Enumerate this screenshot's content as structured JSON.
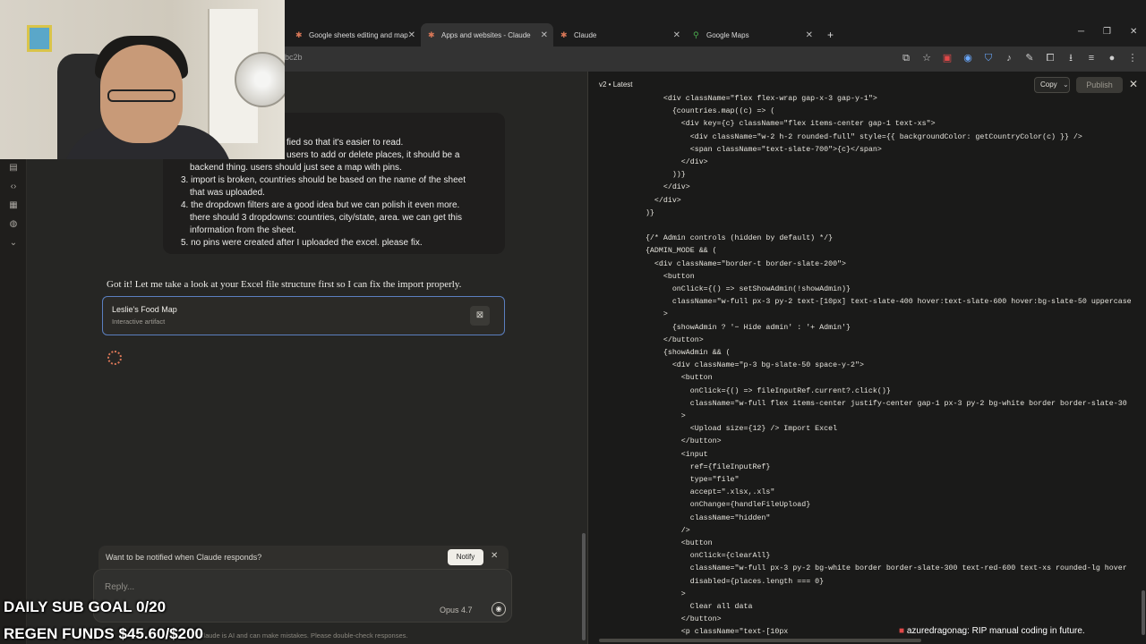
{
  "browser": {
    "tabs": [
      {
        "label": "Google sheets editing and map",
        "active": false
      },
      {
        "label": "Apps and websites - Claude",
        "active": true
      },
      {
        "label": "Claude",
        "active": false
      },
      {
        "label": "Google Maps",
        "active": false
      }
    ],
    "url_fragment": "bc2b"
  },
  "conversation": {
    "user_message_lines": [
      "fied so that it's easier to read.",
      "users to add or delete places, it should be a",
      "backend thing. users should just see a map with pins.",
      "3. import is broken, countries should be based on the name of the sheet",
      "that was uploaded.",
      "4. the dropdown filters are a good idea but we can polish it even more.",
      "there should 3 dropdowns: countries, city/state, area. we can get this",
      "information from the sheet.",
      "5. no pins were created after I uploaded the excel. please fix."
    ],
    "assistant_reply": "Got it! Let me take a look at your Excel file structure first so I can fix the import properly.",
    "artifact": {
      "title": "Leslie's Food Map",
      "subtitle": "Interactive artifact"
    },
    "notify_prompt": "Want to be notified when Claude responds?",
    "notify_button": "Notify",
    "reply_placeholder": "Reply...",
    "model": "Opus 4.7",
    "disclaimer": "Claude is AI and can make mistakes. Please double-check responses."
  },
  "code_panel": {
    "version": "v2 • Latest",
    "copy_label": "Copy",
    "publish_label": "Publish",
    "lines": [
      "      <div className=\"flex flex-wrap gap-x-3 gap-y-1\">",
      "        {countries.map((c) => (",
      "          <div key={c} className=\"flex items-center gap-1 text-xs\">",
      "            <div className=\"w-2 h-2 rounded-full\" style={{ backgroundColor: getCountryColor(c) }} />",
      "            <span className=\"text-slate-700\">{c}</span>",
      "          </div>",
      "        ))}",
      "      </div>",
      "    </div>",
      "  )}",
      "",
      "  {/* Admin controls (hidden by default) */}",
      "  {ADMIN_MODE && (",
      "    <div className=\"border-t border-slate-200\">",
      "      <button",
      "        onClick={() => setShowAdmin(!showAdmin)}",
      "        className=\"w-full px-3 py-2 text-[10px] text-slate-400 hover:text-slate-600 hover:bg-slate-50 uppercase",
      "      >",
      "        {showAdmin ? '− Hide admin' : '+ Admin'}",
      "      </button>",
      "      {showAdmin && (",
      "        <div className=\"p-3 bg-slate-50 space-y-2\">",
      "          <button",
      "            onClick={() => fileInputRef.current?.click()}",
      "            className=\"w-full flex items-center justify-center gap-1 px-3 py-2 bg-white border border-slate-30",
      "          >",
      "            <Upload size={12} /> Import Excel",
      "          </button>",
      "          <input",
      "            ref={fileInputRef}",
      "            type=\"file\"",
      "            accept=\".xlsx,.xls\"",
      "            onChange={handleFileUpload}",
      "            className=\"hidden\"",
      "          />",
      "          <button",
      "            onClick={clearAll}",
      "            className=\"w-full px-3 py-2 bg-white border border-slate-300 text-red-600 text-xs rounded-lg hover",
      "            disabled={places.length === 0}",
      "          >",
      "            Clear all data",
      "          </button>",
      "          <p className=\"text-[10px"
    ]
  },
  "stream_overlay": {
    "sub_goal": "DAILY SUB GOAL 0/20",
    "regen_funds": "REGEN FUNDS $45.60/$200",
    "chat_user": "azuredragonag:",
    "chat_text": "RIP manual coding in future."
  },
  "colors": {
    "accent": "#d97757",
    "artifact_border": "#5b7fbf"
  }
}
